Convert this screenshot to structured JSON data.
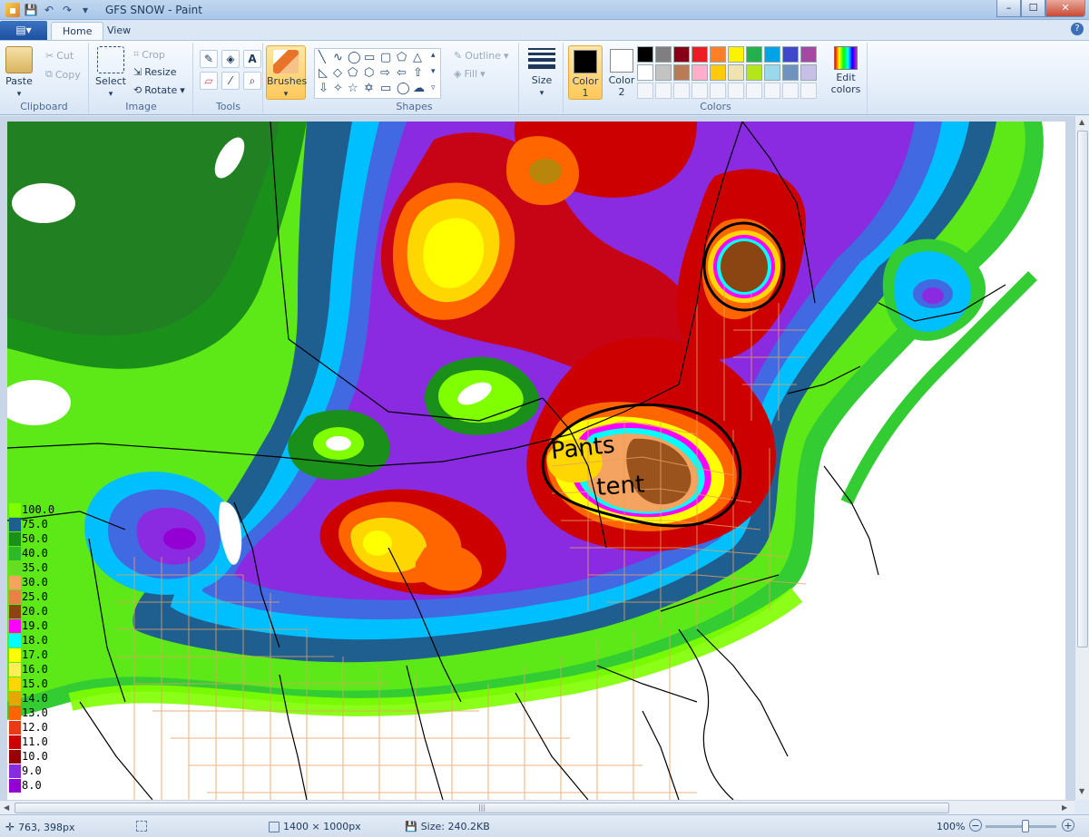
{
  "window": {
    "title": "GFS SNOW - Paint",
    "min": "–",
    "max": "☐",
    "close": "✕"
  },
  "tabs": {
    "app_menu": "▤▾",
    "home": "Home",
    "view": "View",
    "help": "?"
  },
  "clipboard": {
    "label": "Clipboard",
    "paste": "Paste",
    "cut": "Cut",
    "copy": "Copy"
  },
  "image": {
    "label": "Image",
    "select": "Select",
    "crop": "Crop",
    "resize": "Resize",
    "rotate": "Rotate"
  },
  "tools": {
    "label": "Tools",
    "pencil": "✎",
    "fill": "◈",
    "text": "A",
    "eraser": "▱",
    "picker": "⁄",
    "magnifier": "⌕"
  },
  "brushes": {
    "label": "Brushes"
  },
  "shapes": {
    "label": "Shapes",
    "outline": "Outline",
    "fill": "Fill"
  },
  "size": {
    "label": "Size"
  },
  "colors": {
    "label": "Colors",
    "color1": "Color 1",
    "color2": "Color 2",
    "edit": "Edit colors",
    "color1_value": "#000000",
    "color2_value": "#ffffff",
    "row1": [
      "#000000",
      "#7f7f7f",
      "#880015",
      "#ed1c24",
      "#ff7f27",
      "#fff200",
      "#22b14c",
      "#00a2e8",
      "#3f48cc",
      "#a349a4"
    ],
    "row2": [
      "#ffffff",
      "#c3c3c3",
      "#b97a57",
      "#ffaec9",
      "#ffc90e",
      "#efe4b0",
      "#b5e61d",
      "#99d9ea",
      "#7092be",
      "#c8bfe7"
    ]
  },
  "annotation": {
    "line1": "Pants",
    "line2": "tent"
  },
  "legend": [
    {
      "v": "100.0",
      "c": "#7fff00"
    },
    {
      "v": "75.0",
      "c": "#1f5f8f"
    },
    {
      "v": "50.0",
      "c": "#1a8f1a"
    },
    {
      "v": "40.0",
      "c": "#2eb82e"
    },
    {
      "v": "35.0",
      "c": "#66dd22"
    },
    {
      "v": "30.0",
      "c": "#f4a460"
    },
    {
      "v": "25.0",
      "c": "#e8804a"
    },
    {
      "v": "20.0",
      "c": "#8b4513"
    },
    {
      "v": "19.0",
      "c": "#ff00ff"
    },
    {
      "v": "18.0",
      "c": "#00ffff"
    },
    {
      "v": "17.0",
      "c": "#ffff00"
    },
    {
      "v": "16.0",
      "c": "#ffee55"
    },
    {
      "v": "15.0",
      "c": "#ffd700"
    },
    {
      "v": "14.0",
      "c": "#e6a800"
    },
    {
      "v": "13.0",
      "c": "#ff6600"
    },
    {
      "v": "12.0",
      "c": "#e83a14"
    },
    {
      "v": "11.0",
      "c": "#cc0000"
    },
    {
      "v": "10.0",
      "c": "#990000"
    },
    {
      "v": "9.0",
      "c": "#8a2be2"
    },
    {
      "v": "8.0",
      "c": "#9400d3"
    }
  ],
  "status": {
    "cursor": "763, 398px",
    "dimensions": "1400 × 1000px",
    "size": "Size: 240.2KB",
    "zoom": "100%",
    "zoom_out": "−",
    "zoom_in": "+"
  }
}
